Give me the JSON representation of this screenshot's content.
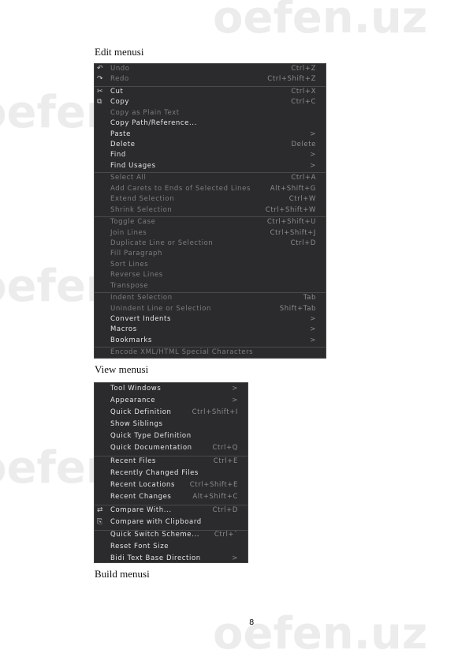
{
  "captions": {
    "edit": "Edit menusi",
    "view": "View menusi",
    "build": "Build menusi"
  },
  "page_number": "8",
  "watermark": "oefen.uz",
  "edit_menu": [
    {
      "label": "Undo",
      "shortcut": "Ctrl+Z",
      "enabled": false,
      "icon": "undo-icon",
      "glyph": "↶"
    },
    {
      "label": "Redo",
      "shortcut": "Ctrl+Shift+Z",
      "enabled": false,
      "icon": "redo-icon",
      "glyph": "↷",
      "sep_after": true
    },
    {
      "label": "Cut",
      "shortcut": "Ctrl+X",
      "enabled": true,
      "icon": "scissors-icon",
      "glyph": "✂"
    },
    {
      "label": "Copy",
      "shortcut": "Ctrl+C",
      "enabled": true,
      "icon": "copy-icon",
      "glyph": "⧉"
    },
    {
      "label": "Copy as Plain Text",
      "shortcut": "",
      "enabled": false
    },
    {
      "label": "Copy Path/Reference...",
      "shortcut": "",
      "enabled": true
    },
    {
      "label": "Paste",
      "shortcut": ">",
      "enabled": true
    },
    {
      "label": "Delete",
      "shortcut": "Delete",
      "enabled": true
    },
    {
      "label": "Find",
      "shortcut": ">",
      "enabled": true
    },
    {
      "label": "Find Usages",
      "shortcut": ">",
      "enabled": true,
      "sep_after": true
    },
    {
      "label": "Select All",
      "shortcut": "Ctrl+A",
      "enabled": false
    },
    {
      "label": "Add Carets to Ends of Selected Lines",
      "shortcut": "Alt+Shift+G",
      "enabled": false
    },
    {
      "label": "Extend Selection",
      "shortcut": "Ctrl+W",
      "enabled": false
    },
    {
      "label": "Shrink Selection",
      "shortcut": "Ctrl+Shift+W",
      "enabled": false,
      "sep_after": true
    },
    {
      "label": "Toggle Case",
      "shortcut": "Ctrl+Shift+U",
      "enabled": false
    },
    {
      "label": "Join Lines",
      "shortcut": "Ctrl+Shift+J",
      "enabled": false
    },
    {
      "label": "Duplicate Line or Selection",
      "shortcut": "Ctrl+D",
      "enabled": false
    },
    {
      "label": "Fill Paragraph",
      "shortcut": "",
      "enabled": false
    },
    {
      "label": "Sort Lines",
      "shortcut": "",
      "enabled": false
    },
    {
      "label": "Reverse Lines",
      "shortcut": "",
      "enabled": false
    },
    {
      "label": "Transpose",
      "shortcut": "",
      "enabled": false,
      "sep_after": true
    },
    {
      "label": "Indent Selection",
      "shortcut": "Tab",
      "enabled": false
    },
    {
      "label": "Unindent Line or Selection",
      "shortcut": "Shift+Tab",
      "enabled": false
    },
    {
      "label": "Convert Indents",
      "shortcut": ">",
      "enabled": true
    },
    {
      "label": "Macros",
      "shortcut": ">",
      "enabled": true
    },
    {
      "label": "Bookmarks",
      "shortcut": ">",
      "enabled": true,
      "sep_after": true
    },
    {
      "label": "Encode XML/HTML Special Characters",
      "shortcut": "",
      "enabled": false
    }
  ],
  "view_menu": [
    {
      "label": "Tool Windows",
      "shortcut": ">",
      "enabled": true
    },
    {
      "label": "Appearance",
      "shortcut": ">",
      "enabled": true
    },
    {
      "label": "Quick Definition",
      "shortcut": "Ctrl+Shift+I",
      "enabled": true
    },
    {
      "label": "Show Siblings",
      "shortcut": "",
      "enabled": true
    },
    {
      "label": "Quick Type Definition",
      "shortcut": "",
      "enabled": true
    },
    {
      "label": "Quick Documentation",
      "shortcut": "Ctrl+Q",
      "enabled": true,
      "sep_after": true
    },
    {
      "label": "Recent Files",
      "shortcut": "Ctrl+E",
      "enabled": true
    },
    {
      "label": "Recently Changed Files",
      "shortcut": "",
      "enabled": true
    },
    {
      "label": "Recent Locations",
      "shortcut": "Ctrl+Shift+E",
      "enabled": true
    },
    {
      "label": "Recent Changes",
      "shortcut": "Alt+Shift+C",
      "enabled": true,
      "sep_after": true
    },
    {
      "label": "Compare With...",
      "shortcut": "Ctrl+D",
      "enabled": true,
      "icon": "compare-icon",
      "glyph": "⇄"
    },
    {
      "label": "Compare with Clipboard",
      "shortcut": "",
      "enabled": true,
      "icon": "clipboard-compare-icon",
      "glyph": "⎘",
      "sep_after": true
    },
    {
      "label": "Quick Switch Scheme...",
      "shortcut": "Ctrl+`",
      "enabled": true
    },
    {
      "label": "Reset Font Size",
      "shortcut": "",
      "enabled": true
    },
    {
      "label": "Bidi Text Base Direction",
      "shortcut": ">",
      "enabled": true
    }
  ]
}
